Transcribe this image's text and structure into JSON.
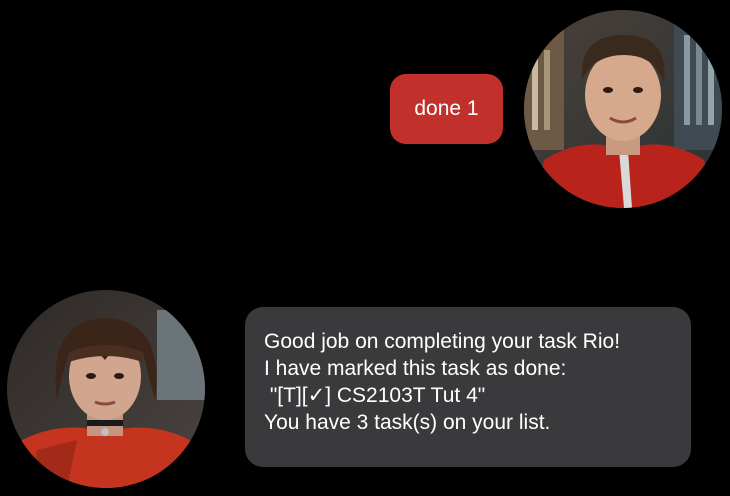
{
  "user_message": {
    "text": "done 1",
    "bubble_color": "#c2302c"
  },
  "bot_message": {
    "lines": [
      "Good job on completing your task Rio!",
      "I have marked this task as done:",
      " \"[T][✓] CS2103T Tut 4\"",
      "You have 3 task(s) on your list."
    ],
    "bubble_color": "#3a3a3c"
  },
  "avatars": {
    "user": "user-avatar-photo",
    "bot": "bot-avatar-photo"
  },
  "colors": {
    "background": "#000000",
    "text": "#ffffff"
  }
}
